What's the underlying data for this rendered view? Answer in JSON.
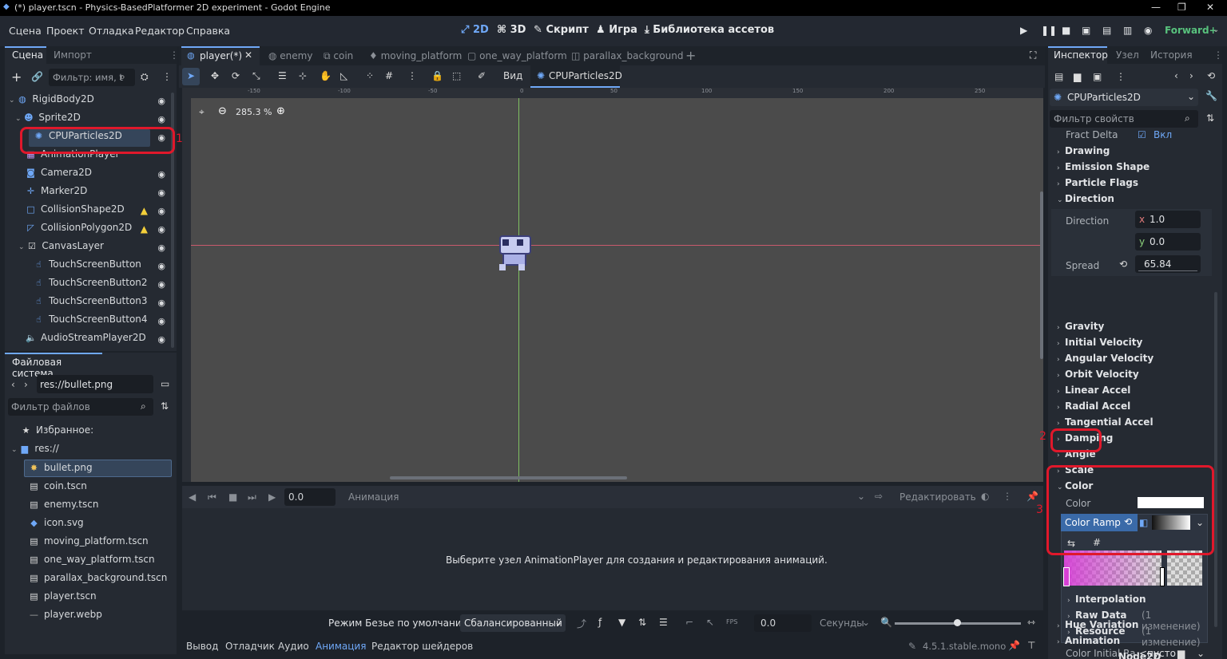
{
  "title": "(*) player.tscn - Physics-BasedPlatformer 2D experiment - Godot Engine",
  "menu": [
    "Сцена",
    "Проект",
    "Отладка",
    "Редактор",
    "Справка"
  ],
  "workspaces": {
    "w2d": "2D",
    "w3d": "3D",
    "script": "Скрипт",
    "game": "Игра",
    "assets": "Библиотека ассетов"
  },
  "renderer": "Forward+",
  "scene_panel": {
    "tab_scene": "Сцена",
    "tab_import": "Импорт",
    "filter_placeholder": "Фильтр: имя, t",
    "nodes": [
      {
        "label": "RigidBody2D"
      },
      {
        "label": "Sprite2D"
      },
      {
        "label": "CPUParticles2D"
      },
      {
        "label": "AnimationPlayer"
      },
      {
        "label": "Camera2D"
      },
      {
        "label": "Marker2D"
      },
      {
        "label": "CollisionShape2D"
      },
      {
        "label": "CollisionPolygon2D"
      },
      {
        "label": "CanvasLayer"
      },
      {
        "label": "TouchScreenButton"
      },
      {
        "label": "TouchScreenButton2"
      },
      {
        "label": "TouchScreenButton3"
      },
      {
        "label": "TouchScreenButton4"
      },
      {
        "label": "AudioStreamPlayer2D"
      }
    ]
  },
  "filesystem": {
    "title": "Файловая система",
    "path": "res://bullet.png",
    "filter_placeholder": "Фильтр файлов",
    "favorites": "Избранное:",
    "root": "res://",
    "files": [
      "bullet.png",
      "coin.tscn",
      "enemy.tscn",
      "icon.svg",
      "moving_platform.tscn",
      "one_way_platform.tscn",
      "parallax_background.tscn",
      "player.tscn",
      "player.webp"
    ]
  },
  "scene_tabs": [
    "player(*)",
    "enemy",
    "coin",
    "moving_platform",
    "one_way_platform",
    "parallax_background"
  ],
  "viewport": {
    "view_label": "Вид",
    "node_label": "CPUParticles2D",
    "zoom": "285.3 %",
    "ruler": [
      "-150",
      "-100",
      "-50",
      "0",
      "50",
      "100",
      "150",
      "200",
      "250"
    ]
  },
  "animation": {
    "time": "0.0",
    "name_placeholder": "Анимация",
    "edit": "Редактировать",
    "message": "Выберите узел AnimationPlayer для создания и редактирования анимаций.",
    "bezier_label": "Режим Безье по умолчанию:",
    "bezier_value": "Сбалансированный",
    "time2": "0.0",
    "units": "Секунды"
  },
  "bottom_tabs": [
    "Вывод",
    "Отладчик",
    "Аудио",
    "Анимация",
    "Редактор шейдеров"
  ],
  "version": "4.5.1.stable.mono",
  "inspector": {
    "tabs": [
      "Инспектор",
      "Узел",
      "История"
    ],
    "node": "CPUParticles2D",
    "filter_placeholder": "Фильтр свойств",
    "fract_label": "Fract Delta",
    "fract_value": "Вкл",
    "sections1": [
      "Drawing",
      "Emission Shape",
      "Particle Flags"
    ],
    "direction": "Direction",
    "direction_label": "Direction",
    "dir_x": "1.0",
    "dir_y": "0.0",
    "spread_label": "Spread",
    "spread_value": "65.84",
    "sections2": [
      "Gravity",
      "Initial Velocity",
      "Angular Velocity",
      "Orbit Velocity",
      "Linear Accel",
      "Radial Accel",
      "Tangential Accel",
      "Damping",
      "Angle",
      "Scale"
    ],
    "color_section": "Color",
    "color_label": "Color",
    "color_ramp": "Color Ramp",
    "interpolation": "Interpolation",
    "raw_data": "Raw Data",
    "raw_changes": "(1 изменение)",
    "resource": "Resource",
    "res_changes": "(1 изменение)",
    "color_initial": "Color Initial Ra",
    "color_initial_val": "<пусто",
    "hue": "Hue Variation",
    "anim": "Animation",
    "node2d": "Node2D"
  },
  "annotations": {
    "n1": "1",
    "n2": "2",
    "n3": "3"
  },
  "colors": {
    "accent": "#6fa8f7",
    "annotation": "#e0182b",
    "canvas": "#4b4b4b"
  }
}
